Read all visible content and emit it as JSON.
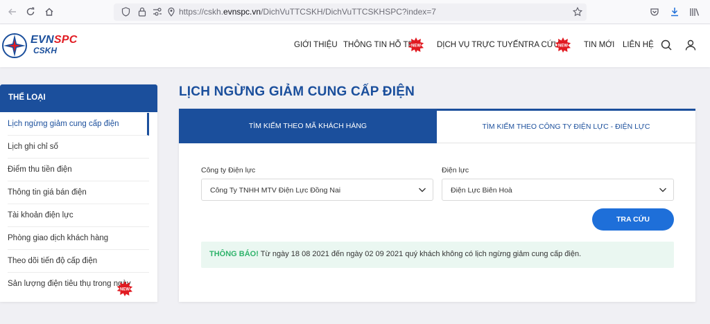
{
  "browser": {
    "url_prefix": "https://cskh.",
    "url_host": "evnspc.vn",
    "url_path": "/DichVuTTCSKH/DichVuTTCSKHSPC?index=7"
  },
  "logo": {
    "evn": "EVN",
    "spc": "SPC",
    "cskh": "CSKH"
  },
  "nav": {
    "items": [
      "GIỚI THIỆU",
      "THÔNG TIN HỖ TRỢ",
      "DỊCH VỤ TRỰC TUYẾN",
      "TRA CỨU",
      "TIN MỚI",
      "LIÊN HỆ"
    ],
    "badge_text": "NEW"
  },
  "sidebar": {
    "title": "THỂ LOẠI",
    "items": [
      "Lịch ngừng giảm cung cấp điện",
      "Lịch ghi chỉ số",
      "Điểm thu tiền điện",
      "Thông tin giá bán điện",
      "Tài khoản điện lực",
      "Phòng giao dịch khách hàng",
      "Theo dõi tiến độ cấp điện",
      "Sản lượng điện tiêu thụ trong ngày"
    ]
  },
  "main": {
    "title": "LỊCH NGỪNG GIẢM CUNG CẤP ĐIỆN",
    "tabs": [
      "TÌM KIẾM THEO MÃ KHÁCH HÀNG",
      "TÌM KIẾM THEO CÔNG TY ĐIỆN LỰC - ĐIỆN LỰC"
    ],
    "company_label": "Công ty Điện lực",
    "company_value": "Công Ty TNHH MTV Điện Lực Đồng Nai",
    "branch_label": "Điện lực",
    "branch_value": "Điện Lực Biên Hoà",
    "search_button": "TRA CỨU",
    "notice_label": "THÔNG BÁO!",
    "notice_text": " Từ ngày 18  08  2021 đến ngày 02  09  2021 quý khách không có lịch ngừng giảm cung cấp điện."
  },
  "colors": {
    "brand": "#1b4f9c",
    "button": "#1e6fd9",
    "notice_bg": "#eaf7f1",
    "notice_label": "#2fb36b",
    "badge": "#e11b22"
  }
}
